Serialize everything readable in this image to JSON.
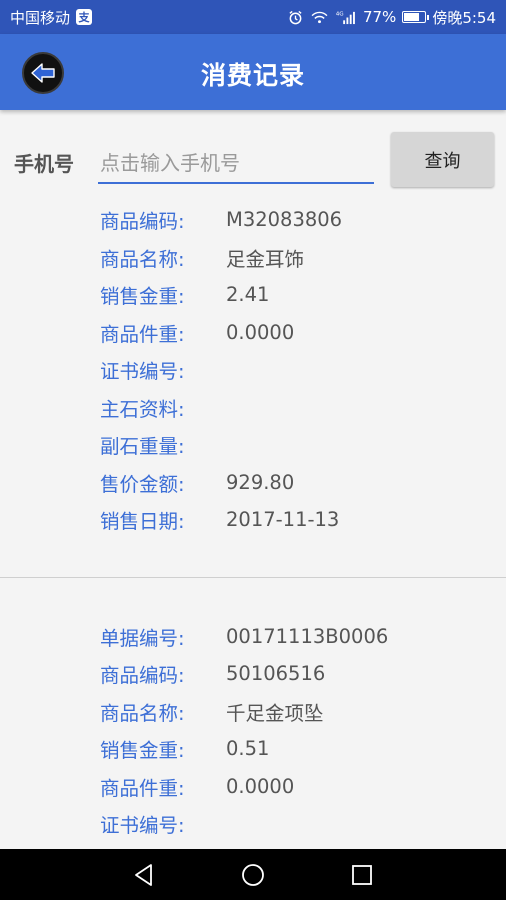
{
  "status_bar": {
    "carrier": "中国移动",
    "pay_icon": "支",
    "alarm_icon": "alarm-icon",
    "wifi_icon": "wifi-icon",
    "signal_icon": "signal-icon",
    "network": "4G",
    "battery_text": "77%",
    "battery_level": 0.77,
    "time": "傍晚5:54"
  },
  "header": {
    "title": "消费记录",
    "back_icon": "back-arrow-icon"
  },
  "search": {
    "label": "手机号",
    "placeholder": "点击输入手机号",
    "value": "",
    "button_label": "查询"
  },
  "records": [
    {
      "fields": [
        {
          "label": "商品编码:",
          "value": "M32083806"
        },
        {
          "label": "商品名称:",
          "value": "足金耳饰"
        },
        {
          "label": "销售金重:",
          "value": "2.41"
        },
        {
          "label": "商品件重:",
          "value": "0.0000"
        },
        {
          "label": "证书编号:",
          "value": ""
        },
        {
          "label": "主石资料:",
          "value": ""
        },
        {
          "label": "副石重量:",
          "value": ""
        },
        {
          "label": "售价金额:",
          "value": "929.80"
        },
        {
          "label": "销售日期:",
          "value": "2017-11-13"
        }
      ]
    },
    {
      "fields": [
        {
          "label": "单据编号:",
          "value": "00171113B0006"
        },
        {
          "label": "商品编码:",
          "value": "50106516"
        },
        {
          "label": "商品名称:",
          "value": "千足金项坠"
        },
        {
          "label": "销售金重:",
          "value": "0.51"
        },
        {
          "label": "商品件重:",
          "value": "0.0000"
        },
        {
          "label": "证书编号:",
          "value": ""
        }
      ]
    }
  ],
  "nav": {
    "back": "nav-back-icon",
    "home": "nav-home-icon",
    "recents": "nav-recents-icon"
  }
}
